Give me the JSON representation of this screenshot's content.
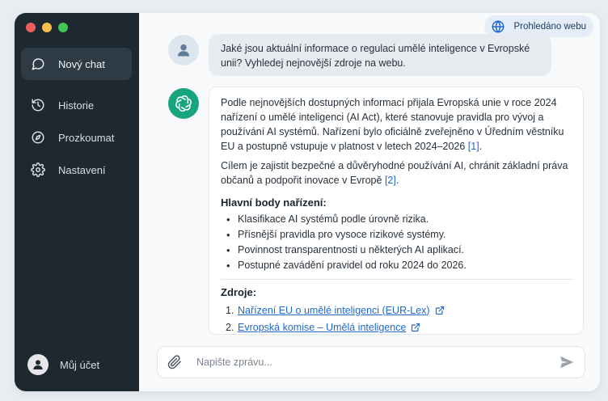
{
  "sidebar": {
    "new_chat": "Nový chat",
    "items": [
      {
        "label": "Historie",
        "icon": "history-icon"
      },
      {
        "label": "Prozkoumat",
        "icon": "compass-icon"
      },
      {
        "label": "Nastavení",
        "icon": "gear-icon"
      }
    ],
    "account_label": "Můj účet"
  },
  "header": {
    "web_badge": "Prohledáno webu"
  },
  "conversation": {
    "user_message": "Jaké jsou aktuální informace o regulaci umělé inteligence v Evropské unii? Vyhledej nejnovější zdroje na webu.",
    "assistant": {
      "para1": "Podle nejnovějších dostupných informací přijala Evropská unie v roce 2024 nařízení o umělé inteligenci (AI Act), které stanovuje pravidla pro vývoj a používání AI systémů. Nařízení bylo oficiálně zveřejněno v Úředním věstníku EU a postupně vstupuje v platnost v letech 2024–2026",
      "ref1": "[1]",
      "para2": "Cílem je zajistit bezpečné a důvěryhodné používání AI, chránit základní práva občanů a podpořit inovace v Evropě",
      "ref2": "[2]",
      "key_points_heading": "Hlavní body nařízení:",
      "key_points": [
        "Klasifikace AI systémů podle úrovně rizika.",
        "Přísnější pravidla pro vysoce rizikové systémy.",
        "Povinnost transparentnosti u některých AI aplikací.",
        "Postupné zavádění pravidel od roku 2024 do 2026."
      ],
      "sources_heading": "Zdroje:",
      "sources": [
        {
          "num": "1.",
          "label": "Nařízení EU o umělé inteligenci (EUR-Lex)"
        },
        {
          "num": "2.",
          "label": "Evropská komise – Umělá inteligence"
        }
      ]
    }
  },
  "composer": {
    "placeholder": "Napište zprávu..."
  },
  "colors": {
    "sidebar_bg": "#1e2830",
    "accent_link": "#2168c8",
    "assistant_avatar": "#16a57f"
  }
}
